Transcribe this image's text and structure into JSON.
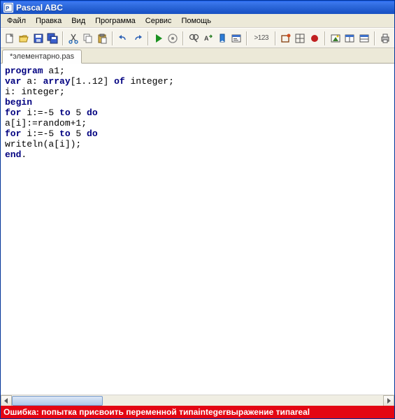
{
  "window": {
    "title": "Pascal ABC"
  },
  "menu": {
    "items": [
      "Файл",
      "Правка",
      "Вид",
      "Программа",
      "Сервис",
      "Помощь"
    ]
  },
  "toolbar": {
    "icons": [
      "new-file-icon",
      "open-file-icon",
      "save-icon",
      "save-all-icon",
      "cut-icon",
      "copy-icon",
      "paste-icon",
      "undo-icon",
      "redo-icon",
      "run-icon",
      "debug-icon",
      "find-icon",
      "replace-icon",
      "bookmark-icon",
      "output-icon",
      "evaluate-icon",
      "step-over-icon",
      "step-into-icon",
      "stop-icon",
      "options-icon",
      "window-icon",
      "window2-icon",
      "print-icon"
    ],
    "evaluate_label": ">123"
  },
  "tabs": [
    {
      "label": "*элементарно.pas"
    }
  ],
  "code": {
    "tokens": [
      {
        "k": "kw",
        "t": "program"
      },
      {
        "t": " a1;"
      },
      {
        "br": 1
      },
      {
        "k": "kw",
        "t": "var"
      },
      {
        "t": " a: "
      },
      {
        "k": "kw",
        "t": "array"
      },
      {
        "t": "[1..12] "
      },
      {
        "k": "kw",
        "t": "of"
      },
      {
        "t": " integer;"
      },
      {
        "br": 1
      },
      {
        "t": "i: integer;"
      },
      {
        "br": 1
      },
      {
        "k": "kw",
        "t": "begin"
      },
      {
        "br": 1
      },
      {
        "k": "kw",
        "t": "for"
      },
      {
        "t": " i:=-5 "
      },
      {
        "k": "kw",
        "t": "to"
      },
      {
        "t": " 5 "
      },
      {
        "k": "kw",
        "t": "do"
      },
      {
        "br": 1
      },
      {
        "t": "a[i]:=random+1;"
      },
      {
        "br": 1
      },
      {
        "k": "kw",
        "t": "for"
      },
      {
        "t": " i:=-5 "
      },
      {
        "k": "kw",
        "t": "to"
      },
      {
        "t": " 5 "
      },
      {
        "k": "kw",
        "t": "do"
      },
      {
        "br": 1
      },
      {
        "t": "writeln(a[i]);"
      },
      {
        "br": 1
      },
      {
        "k": "kw",
        "t": "end"
      },
      {
        "t": "."
      }
    ]
  },
  "error": {
    "prefix": "Ошибка: попытка присвоить переменной типа ",
    "kw1": "integer",
    "middle": " выражение типа ",
    "kw2": "real"
  }
}
